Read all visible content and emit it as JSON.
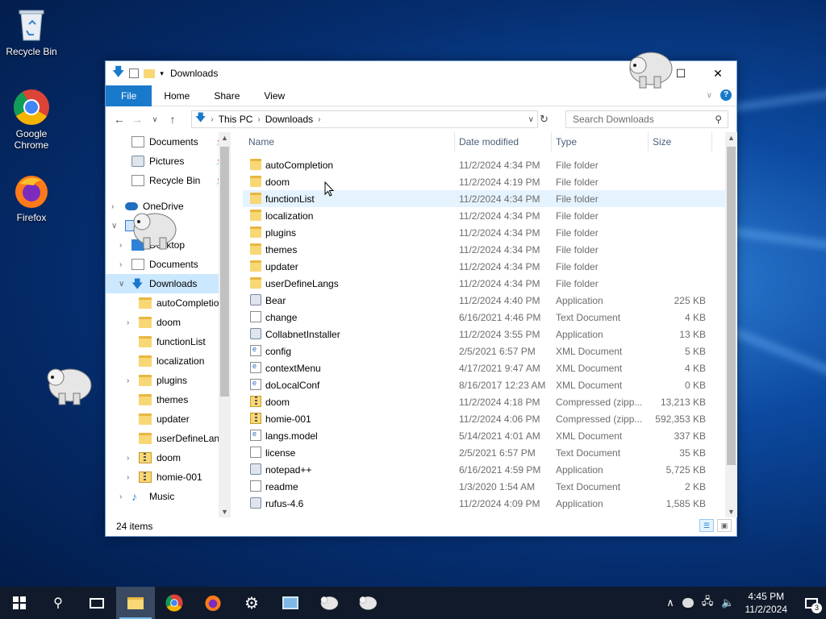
{
  "desktop": {
    "icons": [
      {
        "label": "Recycle Bin"
      },
      {
        "label": "Google Chrome"
      },
      {
        "label": "Firefox"
      }
    ]
  },
  "window": {
    "title": "Downloads",
    "ribbon_tabs": [
      "File",
      "Home",
      "Share",
      "View"
    ],
    "address": {
      "crumbs": [
        "This PC",
        "Downloads"
      ]
    },
    "search_placeholder": "Search Downloads",
    "columns": {
      "name": "Name",
      "date": "Date modified",
      "type": "Type",
      "size": "Size"
    },
    "nav": [
      {
        "label": "Documents",
        "pinned": true
      },
      {
        "label": "Pictures",
        "pinned": true
      },
      {
        "label": "Recycle Bin",
        "pinned": true
      },
      {
        "label": "OneDrive"
      },
      {
        "label": "Desktop"
      },
      {
        "label": "Documents"
      },
      {
        "label": "Downloads"
      },
      {
        "label": "autoCompletion"
      },
      {
        "label": "doom"
      },
      {
        "label": "functionList"
      },
      {
        "label": "localization"
      },
      {
        "label": "plugins"
      },
      {
        "label": "themes"
      },
      {
        "label": "updater"
      },
      {
        "label": "userDefineLangs"
      },
      {
        "label": "doom"
      },
      {
        "label": "homie-001"
      },
      {
        "label": "Music"
      }
    ],
    "files": [
      {
        "name": "autoCompletion",
        "date": "11/2/2024 4:34 PM",
        "type": "File folder",
        "size": "",
        "icon": "folder-icon"
      },
      {
        "name": "doom",
        "date": "11/2/2024 4:19 PM",
        "type": "File folder",
        "size": "",
        "icon": "folder-icon"
      },
      {
        "name": "functionList",
        "date": "11/2/2024 4:34 PM",
        "type": "File folder",
        "size": "",
        "icon": "folder-icon"
      },
      {
        "name": "localization",
        "date": "11/2/2024 4:34 PM",
        "type": "File folder",
        "size": "",
        "icon": "folder-icon"
      },
      {
        "name": "plugins",
        "date": "11/2/2024 4:34 PM",
        "type": "File folder",
        "size": "",
        "icon": "folder-icon"
      },
      {
        "name": "themes",
        "date": "11/2/2024 4:34 PM",
        "type": "File folder",
        "size": "",
        "icon": "folder-icon"
      },
      {
        "name": "updater",
        "date": "11/2/2024 4:34 PM",
        "type": "File folder",
        "size": "",
        "icon": "folder-icon"
      },
      {
        "name": "userDefineLangs",
        "date": "11/2/2024 4:34 PM",
        "type": "File folder",
        "size": "",
        "icon": "folder-icon"
      },
      {
        "name": "Bear",
        "date": "11/2/2024 4:40 PM",
        "type": "Application",
        "size": "225 KB",
        "icon": "app-icon"
      },
      {
        "name": "change",
        "date": "6/16/2021 4:46 PM",
        "type": "Text Document",
        "size": "4 KB",
        "icon": "text-doc-icon"
      },
      {
        "name": "CollabnetInstaller",
        "date": "11/2/2024 3:55 PM",
        "type": "Application",
        "size": "13 KB",
        "icon": "app-icon"
      },
      {
        "name": "config",
        "date": "2/5/2021 6:57 PM",
        "type": "XML Document",
        "size": "5 KB",
        "icon": "xml-doc-icon"
      },
      {
        "name": "contextMenu",
        "date": "4/17/2021 9:47 AM",
        "type": "XML Document",
        "size": "4 KB",
        "icon": "xml-doc-icon"
      },
      {
        "name": "doLocalConf",
        "date": "8/16/2017 12:23 AM",
        "type": "XML Document",
        "size": "0 KB",
        "icon": "xml-doc-icon"
      },
      {
        "name": "doom",
        "date": "11/2/2024 4:18 PM",
        "type": "Compressed (zipp...",
        "size": "13,213 KB",
        "icon": "zip-icon"
      },
      {
        "name": "homie-001",
        "date": "11/2/2024 4:06 PM",
        "type": "Compressed (zipp...",
        "size": "592,353 KB",
        "icon": "zip-icon"
      },
      {
        "name": "langs.model",
        "date": "5/14/2021 4:01 AM",
        "type": "XML Document",
        "size": "337 KB",
        "icon": "xml-doc-icon"
      },
      {
        "name": "license",
        "date": "2/5/2021 6:57 PM",
        "type": "Text Document",
        "size": "35 KB",
        "icon": "text-doc-icon"
      },
      {
        "name": "notepad++",
        "date": "6/16/2021 4:59 PM",
        "type": "Application",
        "size": "5,725 KB",
        "icon": "app-icon"
      },
      {
        "name": "readme",
        "date": "1/3/2020 1:54 AM",
        "type": "Text Document",
        "size": "2 KB",
        "icon": "text-doc-icon"
      },
      {
        "name": "rufus-4.6",
        "date": "11/2/2024 4:09 PM",
        "type": "Application",
        "size": "1,585 KB",
        "icon": "app-icon"
      }
    ],
    "status": "24 items"
  },
  "taskbar": {
    "time": "4:45 PM",
    "date": "11/2/2024",
    "notifications": "3"
  }
}
